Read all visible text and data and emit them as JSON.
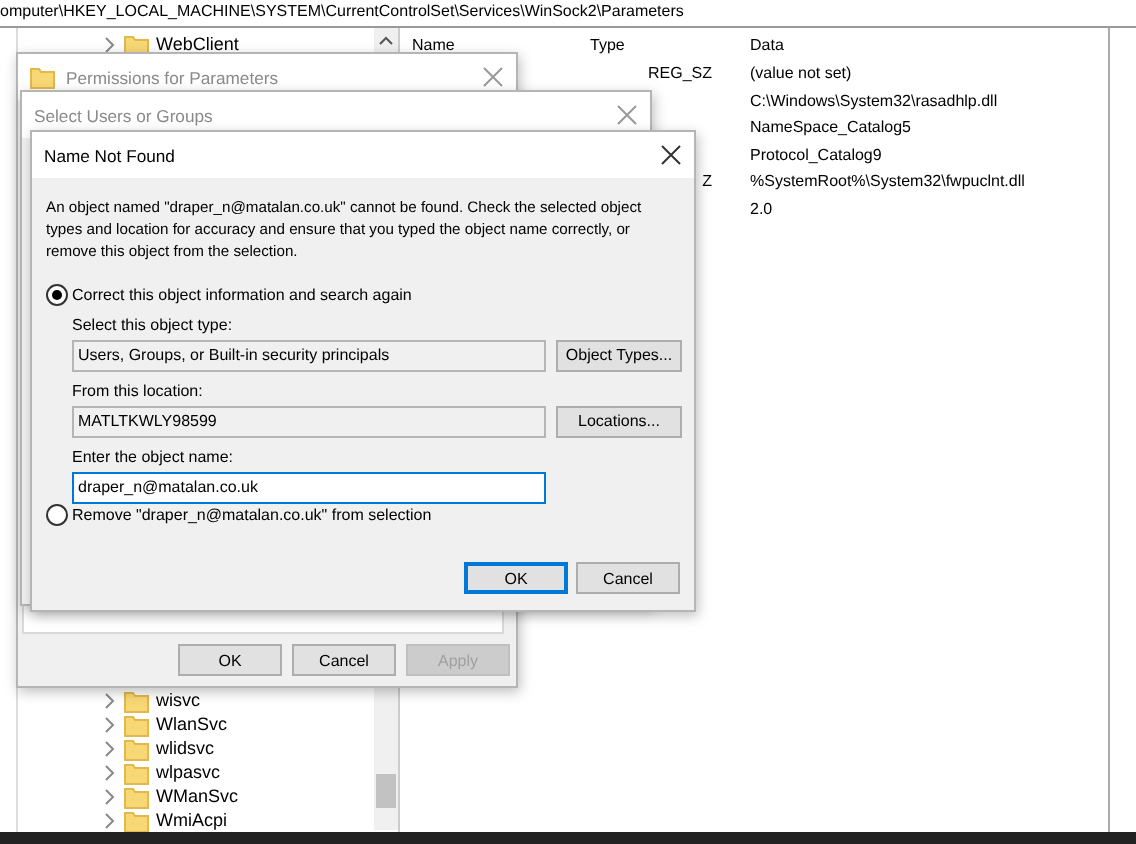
{
  "address_bar": {
    "path": "omputer\\HKEY_LOCAL_MACHINE\\SYSTEM\\CurrentControlSet\\Services\\WinSock2\\Parameters"
  },
  "tree": {
    "top_items": [
      {
        "label": "WebClient",
        "expanded": false
      }
    ],
    "bottom_items": [
      {
        "label": "wisvc",
        "expanded": false
      },
      {
        "label": "WlanSvc",
        "expanded": false
      },
      {
        "label": "wlidsvc",
        "expanded": false
      },
      {
        "label": "wlpasvc",
        "expanded": false
      },
      {
        "label": "WManSvc",
        "expanded": false
      },
      {
        "label": "WmiAcpi",
        "expanded": false
      }
    ]
  },
  "values": {
    "columns": [
      "Name",
      "Type",
      "Data"
    ],
    "rows": [
      {
        "type": "REG_SZ",
        "data": "(value not set)"
      },
      {
        "data": "C:\\Windows\\System32\\rasadhlp.dll"
      },
      {
        "data": "NameSpace_Catalog5"
      },
      {
        "data": "Protocol_Catalog9"
      },
      {
        "type": "Z",
        "data": "%SystemRoot%\\System32\\fwpuclnt.dll"
      },
      {
        "data": "2.0"
      }
    ]
  },
  "permissions_dialog": {
    "title": "Permissions for Parameters",
    "buttons": [
      {
        "label": "OK",
        "disabled": false
      },
      {
        "label": "Cancel",
        "disabled": false
      },
      {
        "label": "Apply",
        "disabled": true
      }
    ]
  },
  "select_users_dialog": {
    "title": "Select Users or Groups"
  },
  "name_not_found_dialog": {
    "title": "Name Not Found",
    "message": "An object named \"draper_n@matalan.co.uk\" cannot be found. Check the selected object types and location for accuracy and ensure that you typed the object name correctly, or remove this object from the selection.",
    "options": [
      {
        "label": "Correct this object information and search again",
        "selected": true
      },
      {
        "label": "Remove \"draper_n@matalan.co.uk\" from selection",
        "selected": false
      }
    ],
    "object_type_label": "Select this object type:",
    "object_type_value": "Users, Groups, or Built-in security principals",
    "object_types_button": "Object Types...",
    "location_label": "From this location:",
    "location_value": "MATLTKWLY98599",
    "locations_button": "Locations...",
    "object_name_label": "Enter the object name:",
    "object_name_value": "draper_n@matalan.co.uk",
    "buttons": [
      {
        "label": "OK",
        "default": true
      },
      {
        "label": "Cancel",
        "default": false
      }
    ]
  }
}
